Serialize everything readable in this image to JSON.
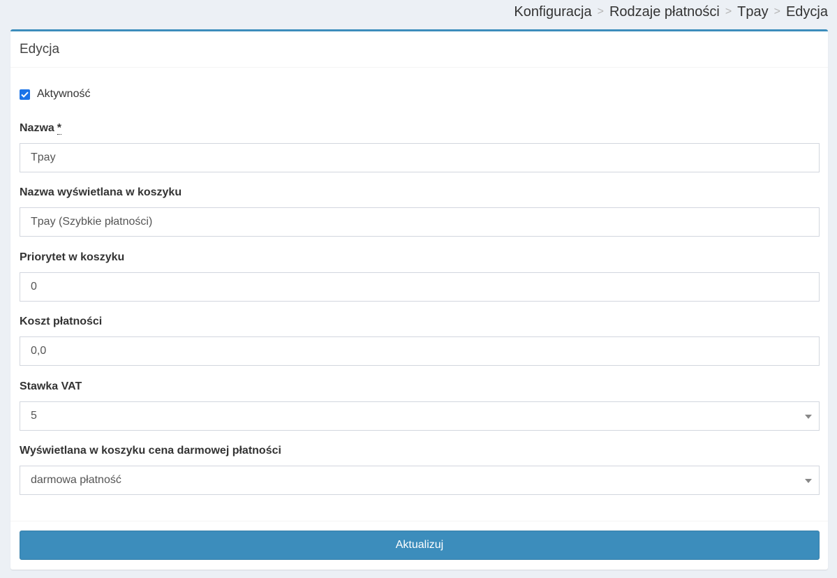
{
  "breadcrumb": {
    "items": [
      "Konfiguracja",
      "Rodzaje płatności",
      "Tpay",
      "Edycja"
    ],
    "separator": ">"
  },
  "panel": {
    "title": "Edycja"
  },
  "form": {
    "active": {
      "label": "Aktywność",
      "checked": true
    },
    "name": {
      "label": "Nazwa",
      "required_mark": "*",
      "value": "Tpay"
    },
    "cart_display_name": {
      "label": "Nazwa wyświetlana w koszyku",
      "value": "Tpay (Szybkie płatności)"
    },
    "cart_priority": {
      "label": "Priorytet w koszyku",
      "value": "0"
    },
    "payment_cost": {
      "label": "Koszt płatności",
      "value": "0,0"
    },
    "vat_rate": {
      "label": "Stawka VAT",
      "value": "5"
    },
    "free_payment_price": {
      "label": "Wyświetlana w koszyku cena darmowej płatności",
      "value": "darmowa płatność"
    }
  },
  "actions": {
    "update_label": "Aktualizuj"
  },
  "colors": {
    "accent": "#3c8dbc",
    "checkbox": "#1a73e8",
    "background": "#ecf0f5"
  },
  "icons": {
    "checkbox": "check-icon",
    "select_caret": "caret-down-icon"
  }
}
